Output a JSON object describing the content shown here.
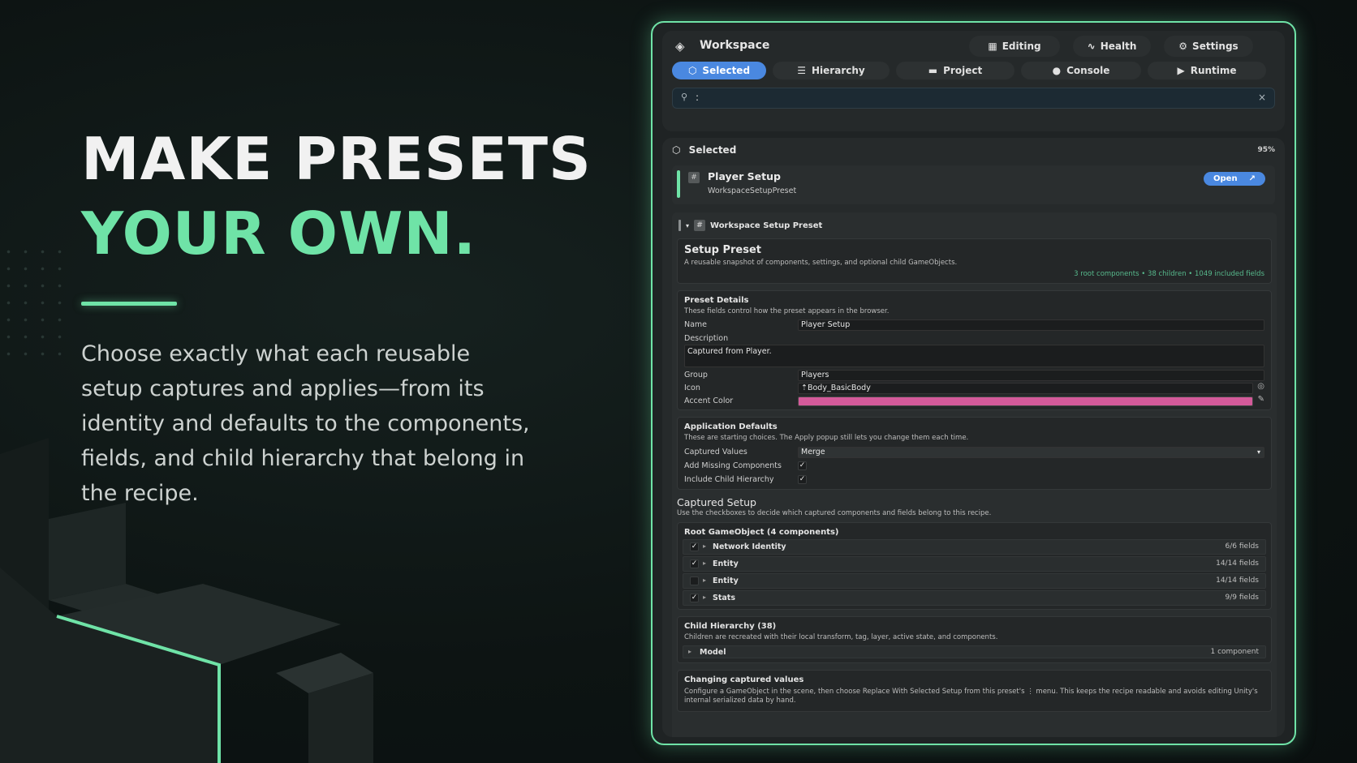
{
  "hero": {
    "line1": "MAKE PRESETS",
    "line2": "YOUR OWN.",
    "body": "Choose exactly what each reusable setup captures and applies—from its identity and defaults to the components, fields, and child hierarchy that belong in the recipe."
  },
  "colors": {
    "accent": "#6fe3a7",
    "blue": "#4a88e0",
    "accent_color_field": "#d45a9a"
  },
  "window": {
    "title": "Workspace",
    "top_buttons": [
      {
        "label": "Editing",
        "icon": "grid-icon"
      },
      {
        "label": "Health",
        "icon": "pulse-icon"
      },
      {
        "label": "Settings",
        "icon": "gear-icon"
      }
    ],
    "tabs": [
      {
        "label": "Selected",
        "icon": "cube-icon",
        "active": true
      },
      {
        "label": "Hierarchy",
        "icon": "list-icon",
        "active": false
      },
      {
        "label": "Project",
        "icon": "folder-icon",
        "active": false
      },
      {
        "label": "Console",
        "icon": "alert-icon",
        "active": false
      },
      {
        "label": "Runtime",
        "icon": "play-icon",
        "active": false
      }
    ],
    "search": {
      "value": ":",
      "clear": "×"
    }
  },
  "selected": {
    "header": "Selected",
    "zoom": "95%",
    "asset_name": "Player Setup",
    "asset_type": "WorkspaceSetupPreset",
    "open_label": "Open"
  },
  "inspector": {
    "header": "Workspace Setup Preset",
    "setup": {
      "title": "Setup Preset",
      "desc": "A reusable snapshot of components, settings, and optional child GameObjects.",
      "meta": "3 root components  •  38 children  •  1049 included fields"
    },
    "details": {
      "title": "Preset Details",
      "desc": "These fields control how the preset appears in the browser.",
      "name_label": "Name",
      "name_value": "Player Setup",
      "description_label": "Description",
      "description_value": "Captured from Player.",
      "group_label": "Group",
      "group_value": "Players",
      "icon_label": "Icon",
      "icon_value": "Body_BasicBody",
      "accent_label": "Accent Color"
    },
    "defaults": {
      "title": "Application Defaults",
      "desc": "These are starting choices. The Apply popup still lets you change them each time.",
      "captured_label": "Captured Values",
      "captured_value": "Merge",
      "add_missing_label": "Add Missing Components",
      "add_missing_checked": true,
      "include_child_label": "Include Child Hierarchy",
      "include_child_checked": true
    },
    "captured": {
      "title": "Captured Setup",
      "desc": "Use the checkboxes to decide which captured components and fields belong to this recipe.",
      "root_title": "Root GameObject (4 components)",
      "rows": [
        {
          "name": "Network Identity",
          "count": "6/6 fields",
          "checked": true
        },
        {
          "name": "Entity",
          "count": "14/14 fields",
          "checked": true
        },
        {
          "name": "Entity",
          "count": "14/14 fields",
          "checked": false
        },
        {
          "name": "Stats",
          "count": "9/9 fields",
          "checked": true
        }
      ]
    },
    "child": {
      "title": "Child Hierarchy (38)",
      "desc": "Children are recreated with their local transform, tag, layer, active state, and components.",
      "row_name": "Model",
      "row_count": "1 component"
    },
    "changing": {
      "title": "Changing captured values",
      "desc": "Configure a GameObject in the scene, then choose Replace With Selected Setup from this preset's ⋮ menu. This keeps the recipe readable and avoids editing Unity's internal serialized data by hand."
    }
  }
}
